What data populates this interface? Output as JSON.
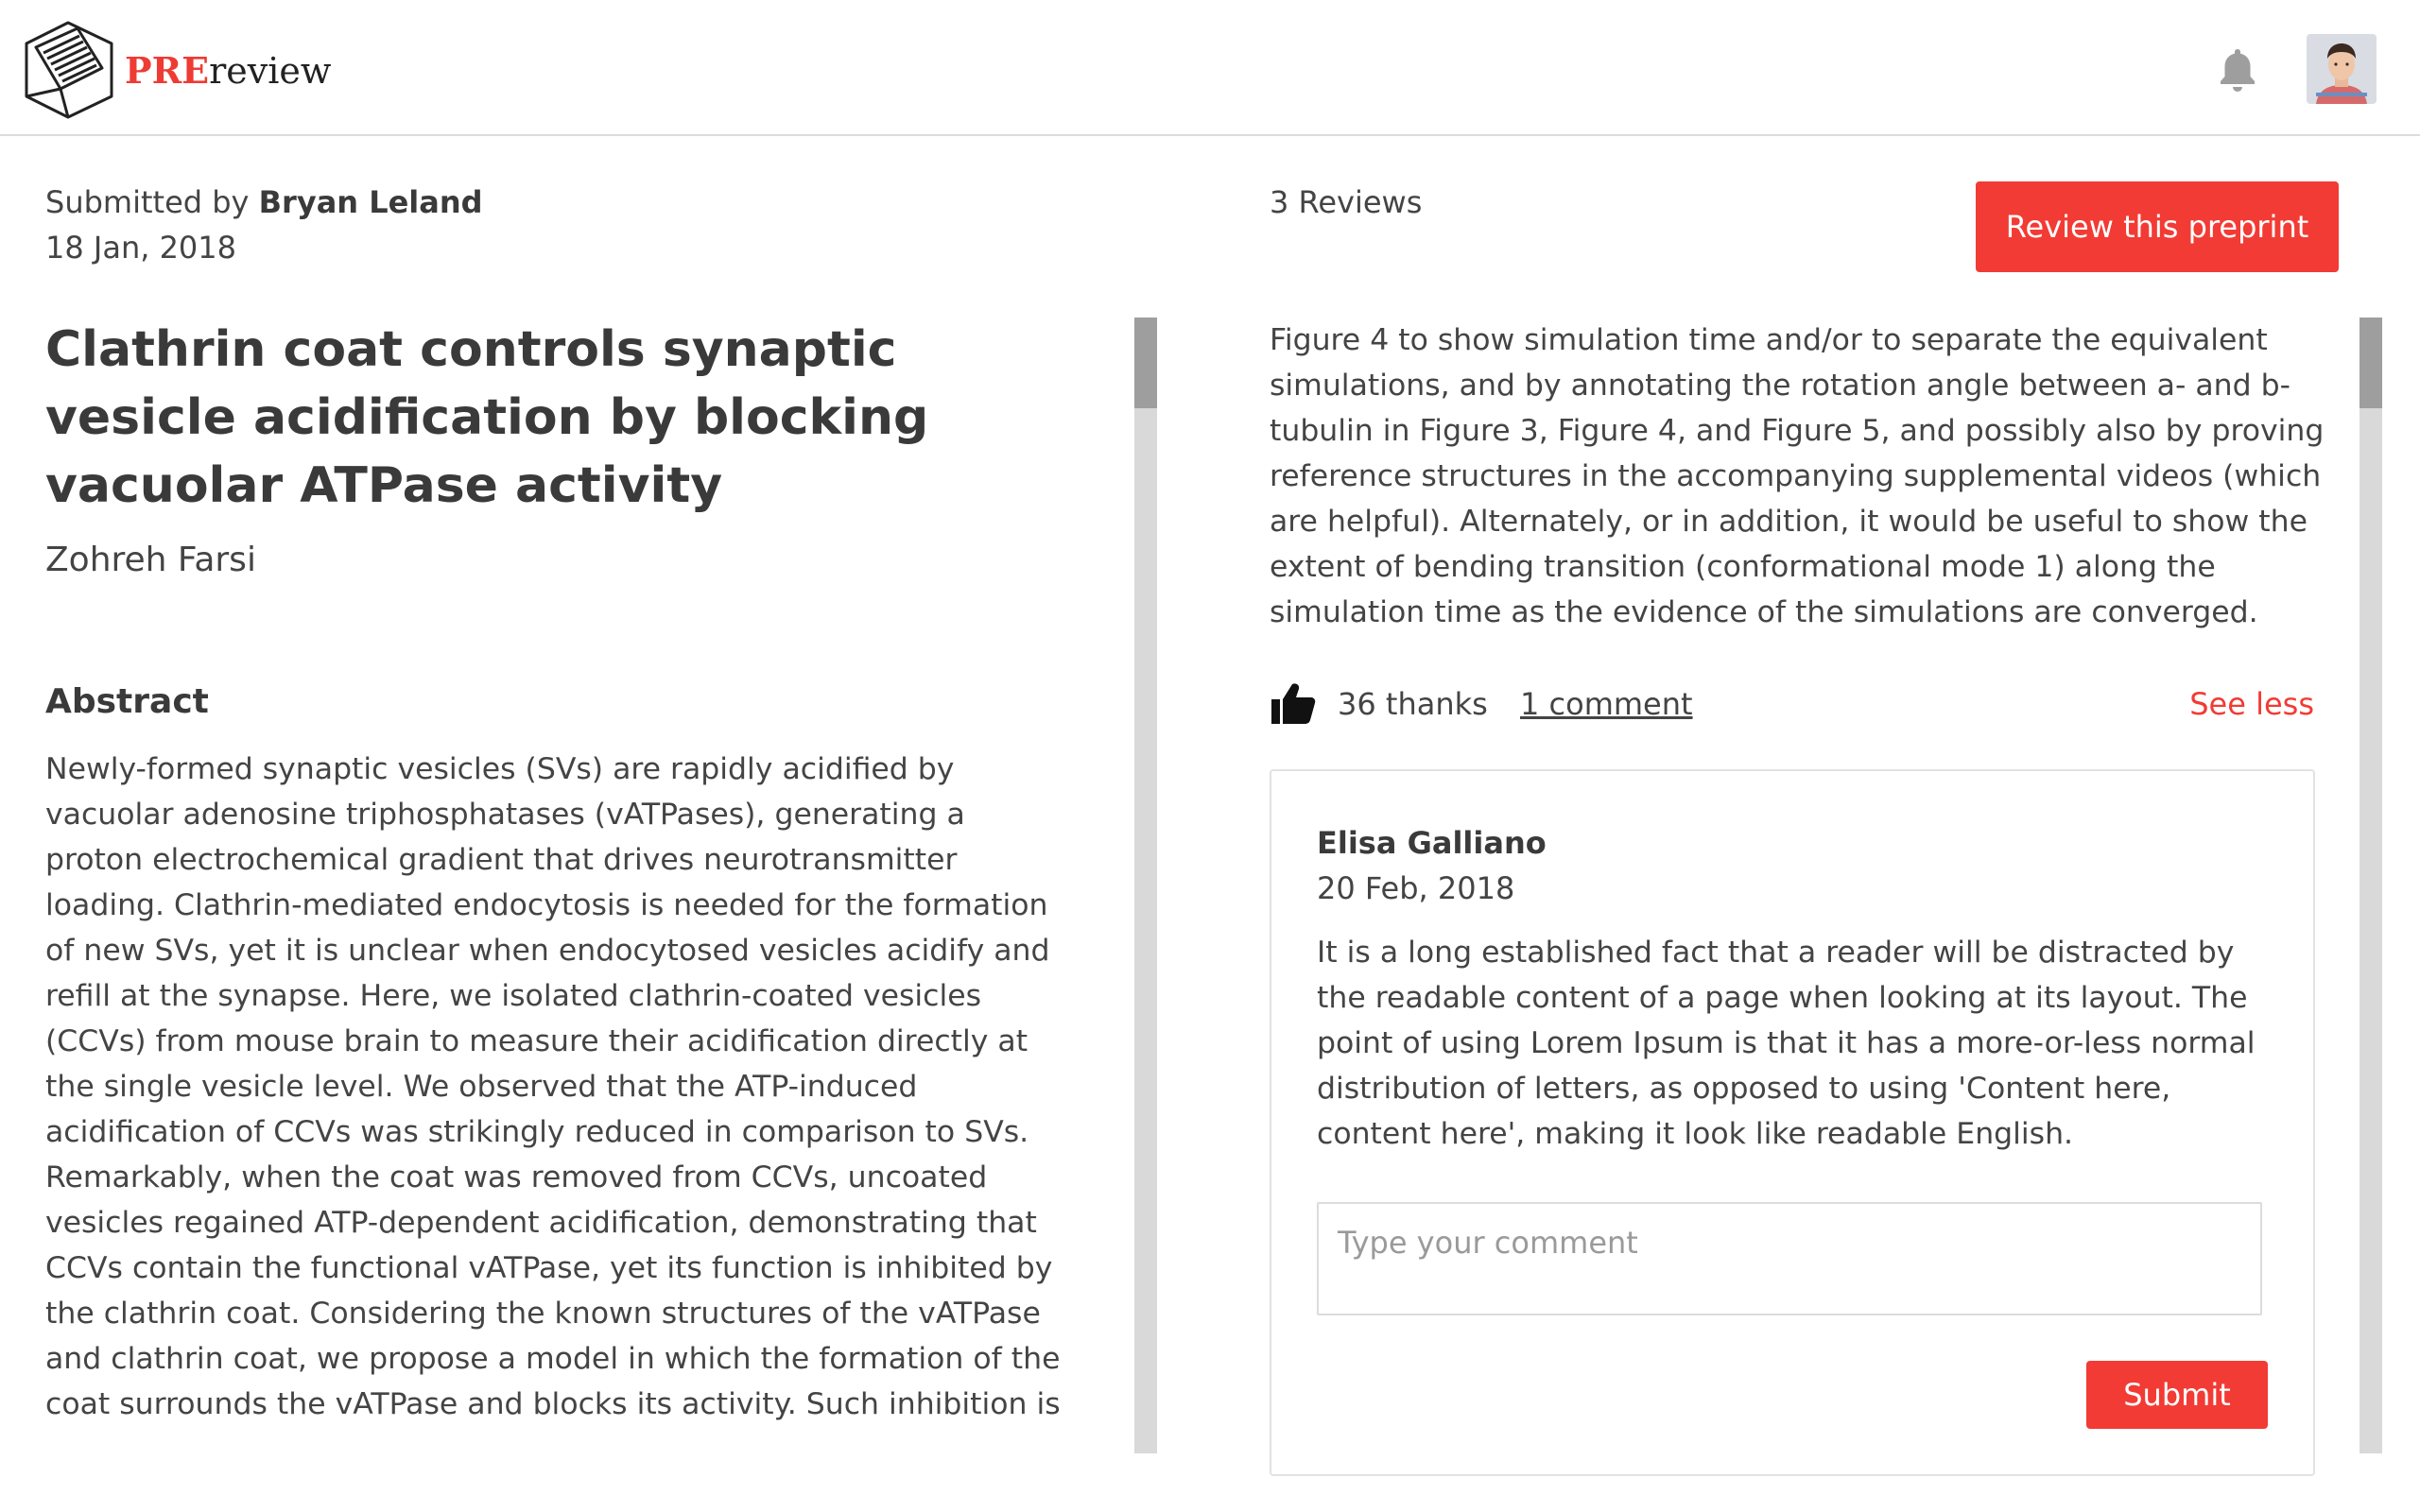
{
  "header": {
    "logo_pre": "PRE",
    "logo_rest": "review",
    "icons": {
      "notifications": "bell-icon",
      "profile": "avatar"
    }
  },
  "preprint": {
    "submitted_prefix": "Submitted by",
    "submitter": "Bryan Leland",
    "date": "18 Jan, 2018",
    "title": "Clathrin coat controls synaptic vesicle acidification by blocking vacuolar ATPase activity",
    "author": "Zohreh Farsi",
    "abstract_heading": "Abstract",
    "abstract": "Newly-formed synaptic vesicles (SVs) are rapidly acidified by vacuolar adenosine triphosphatases (vATPases), generating a proton electrochemical gradient that drives neurotransmitter loading. Clathrin-mediated endocytosis is needed for the formation of new SVs, yet it is unclear when endocytosed vesicles acidify and refill at the synapse. Here, we isolated clathrin-coated vesicles (CCVs) from mouse brain to measure their acidification directly at the single vesicle level. We observed that the ATP-induced acidification of CCVs was strikingly reduced in comparison to SVs. Remarkably, when the coat was removed from CCVs, uncoated vesicles regained ATP-dependent acidification, demonstrating that CCVs contain the functional vATPase, yet its function is inhibited by the clathrin coat. Considering the known structures of the vATPase and clathrin coat, we propose a model in which the formation of the coat surrounds the vATPase and blocks its activity. Such inhibition is likely fundamental for the proper"
  },
  "reviews": {
    "count_label": "3 Reviews",
    "review_button": "Review this preprint",
    "visible_text": "Figure 4 to show simulation time and/or to separate the equivalent simulations, and by annotating the rotation angle between a- and b-tubulin in Figure 3, Figure 4, and Figure 5, and possibly also by proving reference structures in the accompanying supplemental videos (which are helpful). Alternately, or in addition, it would be useful to show the extent of bending transition (conformational mode 1) along the simulation time as the evidence of the simulations are converged.",
    "thanks": "36 thanks",
    "comments_link": "1 comment",
    "see_less": "See less"
  },
  "comment": {
    "author": "Elisa Galliano",
    "date": "20 Feb, 2018",
    "body": "It is a long established fact that a reader will be distracted by the readable content of a page when looking at its layout. The point of using Lorem Ipsum is that it has a more-or-less normal distribution of letters, as opposed to using 'Content here, content here', making it look like readable English.",
    "input_placeholder": "Type your comment",
    "submit_label": "Submit"
  },
  "colors": {
    "accent": "#f23b34",
    "text": "#444444",
    "scroll_track": "#d9d9d9",
    "scroll_thumb": "#9e9e9e"
  }
}
